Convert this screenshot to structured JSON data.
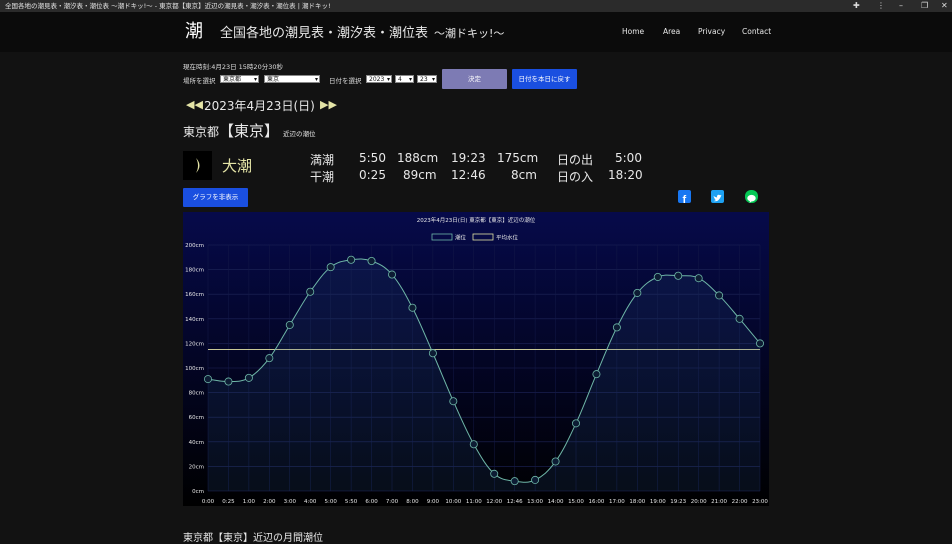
{
  "window": {
    "title": "全国各地の潮見表・潮汐表・潮位表 ～潮ドキッ!～ - 東京都【東京】近辺の潮見表・潮汐表・潮位表 | 潮ドキッ!"
  },
  "site": {
    "logo": "潮",
    "name": "全国各地の潮見表・潮汐表・潮位表",
    "tagline": "～潮ドキッ!～",
    "nav": [
      "Home",
      "Area",
      "Privacy",
      "Contact"
    ]
  },
  "controls": {
    "current_time_label": "現在時刻:4月23日 15時20分30秒",
    "location_label": "場所を選択",
    "prefecture": "東京都",
    "port": "東京",
    "date_label": "日付を選択",
    "year": "2023",
    "month": "4",
    "day": "23",
    "submit_label": "決定",
    "today_label": "日付を本日に戻す"
  },
  "date": {
    "heading": "2023年4月23日(日)",
    "prev_icon": "double-left-arrow-icon",
    "next_icon": "double-right-arrow-icon"
  },
  "place": {
    "pref": "東京都",
    "port": "【東京】",
    "suffix": "近辺の潮位"
  },
  "tide_info": {
    "tide_type": "大潮",
    "moon_icon": "crescent-moon-icon",
    "high_label": "満潮",
    "high1_time": "5:50",
    "high1_level": "188cm",
    "high2_time": "19:23",
    "high2_level": "175cm",
    "low_label": "干潮",
    "low1_time": "0:25",
    "low1_level": "89cm",
    "low2_time": "12:46",
    "low2_level": "8cm",
    "sunrise_label": "日の出",
    "sunrise": "5:00",
    "sunset_label": "日の入",
    "sunset": "18:20"
  },
  "graph_toggle_label": "グラフを非表示",
  "share": {
    "icons": [
      "facebook-icon",
      "twitter-icon",
      "line-icon"
    ],
    "colors": [
      "#1877f2",
      "#1da1f2",
      "#06c755"
    ]
  },
  "chart_data": {
    "type": "line",
    "title": "2023年4月23日(日) 東京都【東京】近辺の潮位",
    "legend": [
      "潮位",
      "平均水位"
    ],
    "legend_placement": "top-center",
    "x": [
      "0:00",
      "0:25",
      "1:00",
      "2:00",
      "3:00",
      "4:00",
      "5:00",
      "5:50",
      "6:00",
      "7:00",
      "8:00",
      "9:00",
      "10:00",
      "11:00",
      "12:00",
      "12:46",
      "13:00",
      "14:00",
      "15:00",
      "16:00",
      "17:00",
      "18:00",
      "19:00",
      "19:23",
      "20:00",
      "21:00",
      "22:00",
      "23:00"
    ],
    "series": [
      {
        "name": "潮位",
        "color": "#6fb7a8",
        "values": [
          91,
          89,
          92,
          108,
          135,
          162,
          182,
          188,
          187,
          176,
          149,
          112,
          73,
          38,
          14,
          8,
          9,
          24,
          55,
          95,
          133,
          161,
          174,
          175,
          173,
          159,
          140,
          120
        ]
      },
      {
        "name": "平均水位",
        "color": "#e4e4a6",
        "values": [
          115,
          115,
          115,
          115,
          115,
          115,
          115,
          115,
          115,
          115,
          115,
          115,
          115,
          115,
          115,
          115,
          115,
          115,
          115,
          115,
          115,
          115,
          115,
          115,
          115,
          115,
          115,
          115
        ]
      }
    ],
    "y_ticks": [
      "0cm",
      "20cm",
      "40cm",
      "60cm",
      "80cm",
      "100cm",
      "120cm",
      "140cm",
      "160cm",
      "180cm",
      "200cm"
    ],
    "ylim": [
      0,
      200
    ],
    "grid": true
  },
  "monthly_heading": "東京都【東京】近辺の月間潮位"
}
